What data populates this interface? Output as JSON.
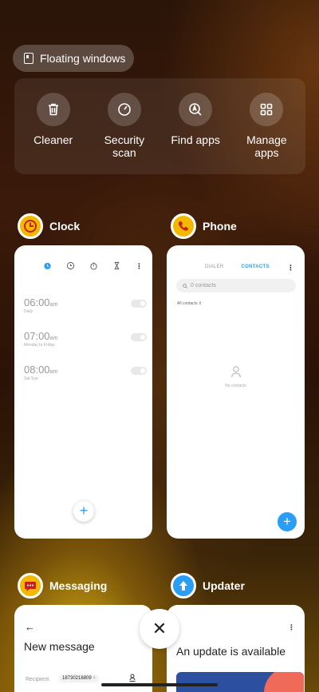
{
  "floating_windows": {
    "label": "Floating windows"
  },
  "tools": [
    {
      "label": "Cleaner",
      "icon": "trash-icon"
    },
    {
      "label": "Security scan",
      "icon": "gauge-icon"
    },
    {
      "label": "Find apps",
      "icon": "search-app-icon"
    },
    {
      "label": "Manage apps",
      "icon": "grid-icon"
    }
  ],
  "apps": {
    "clock": {
      "name": "Clock",
      "alarms": [
        {
          "time": "06:00",
          "ampm": "am",
          "sub": "Daily"
        },
        {
          "time": "07:00",
          "ampm": "am",
          "sub": "Monday to Friday"
        },
        {
          "time": "08:00",
          "ampm": "am",
          "sub": "Sat Sun"
        }
      ],
      "add": "+"
    },
    "phone": {
      "name": "Phone",
      "tab_dialer": "DIALER",
      "tab_contacts": "CONTACTS",
      "search_placeholder": "0 contacts",
      "filter": "All contacts",
      "empty": "No contacts",
      "add": "+"
    },
    "messaging": {
      "name": "Messaging",
      "back": "←",
      "title": "New message",
      "recipient_label": "Recipient",
      "recipient_chip": "18730218809"
    },
    "updater": {
      "name": "Updater",
      "title": "An update is available"
    }
  },
  "close": "✕",
  "colors": {
    "clock_icon": "#f5b800",
    "phone_icon": "#f5b800",
    "messaging_icon": "#f5b800",
    "updater_icon": "#2a9df4",
    "accent_blue": "#2a9df4"
  }
}
